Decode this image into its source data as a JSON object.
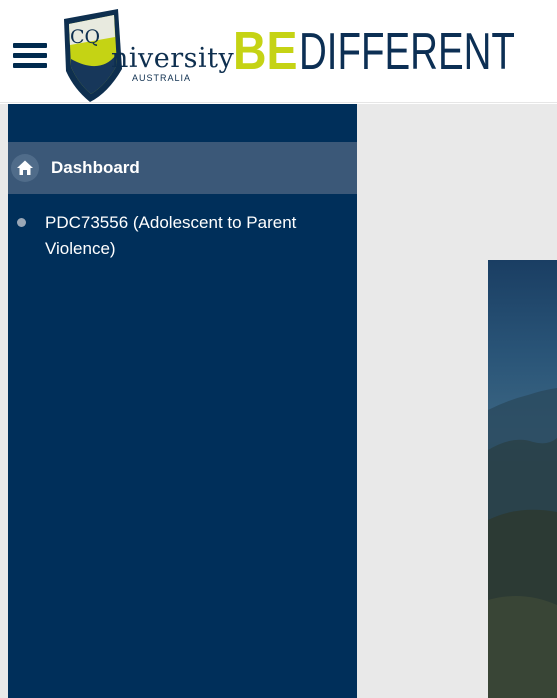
{
  "header": {
    "menu_icon": "hamburger-menu-icon",
    "logo": {
      "cq": "CQ",
      "wordmark": "niversity",
      "subline": "AUSTRALIA",
      "colors": {
        "shield_navy": "#0e2f4f",
        "shield_lime": "#c5d314",
        "shield_light": "#e8eadf"
      }
    },
    "slogan": {
      "be": "BE",
      "different": "DIFFERENT",
      "be_color": "#c5d314",
      "different_color": "#0c2f54"
    }
  },
  "sidebar": {
    "background": "#002f5a",
    "items": [
      {
        "label": "Dashboard",
        "icon": "home-icon",
        "active": true
      },
      {
        "label": "PDC73556 (Adolescent to Parent Violence)",
        "icon": "bullet-icon",
        "active": false
      }
    ]
  },
  "main": {
    "background": "#e9e9e9",
    "hero_image": "mountain-landscape"
  }
}
